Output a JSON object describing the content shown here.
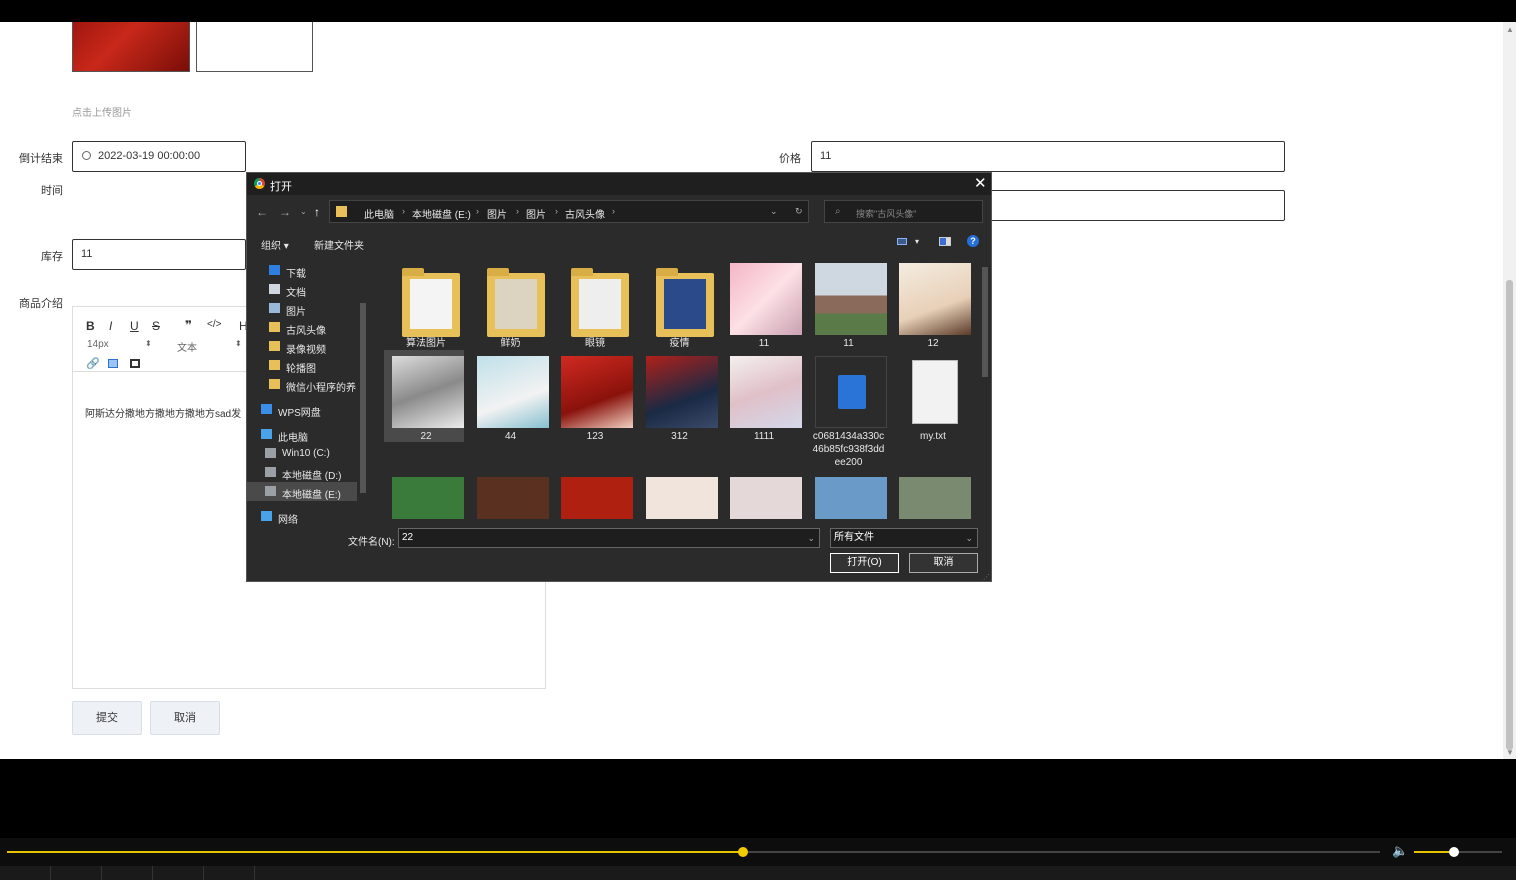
{
  "form": {
    "upload_hint": "点击上传图片",
    "countdown_label_1": "倒计结束",
    "countdown_label_2": "时间",
    "countdown_value": "2022-03-19 00:00:00",
    "price_label": "价格",
    "price_value": "11",
    "stock_label": "库存",
    "stock_value": "11",
    "desc_label": "商品介绍",
    "editor_font_size": "14px",
    "editor_block_type": "文本",
    "editor_content": "阿斯达分撒地方撒地方撒地方sad发",
    "submit_label": "提交",
    "cancel_label": "取消"
  },
  "dialog": {
    "title": "打开",
    "breadcrumb": [
      "此电脑",
      "本地磁盘 (E:)",
      "图片",
      "图片",
      "古风头像"
    ],
    "search_placeholder": "搜索\"古风头像\"",
    "organize_label": "组织 ▾",
    "new_folder_label": "新建文件夹",
    "nav_items": [
      {
        "label": "下载",
        "icon": "download-icon"
      },
      {
        "label": "文档",
        "icon": "document-icon"
      },
      {
        "label": "图片",
        "icon": "pictures-icon"
      },
      {
        "label": "古风头像",
        "icon": "folder-icon"
      },
      {
        "label": "录像视频",
        "icon": "folder-icon"
      },
      {
        "label": "轮播图",
        "icon": "folder-icon"
      },
      {
        "label": "微信小程序的养",
        "icon": "folder-icon"
      },
      {
        "label": "WPS网盘",
        "icon": "cloud-icon"
      },
      {
        "label": "此电脑",
        "icon": "computer-icon"
      },
      {
        "label": "Win10 (C:)",
        "icon": "drive-icon"
      },
      {
        "label": "本地磁盘 (D:)",
        "icon": "drive-icon"
      },
      {
        "label": "本地磁盘 (E:)",
        "icon": "drive-icon"
      },
      {
        "label": "网络",
        "icon": "network-icon"
      }
    ],
    "files": [
      {
        "name": "算法图片",
        "kind": "folder"
      },
      {
        "name": "鲜奶",
        "kind": "folder"
      },
      {
        "name": "眼镜",
        "kind": "folder"
      },
      {
        "name": "疫情",
        "kind": "folder"
      },
      {
        "name": "11",
        "kind": "image"
      },
      {
        "name": "11",
        "kind": "image"
      },
      {
        "name": "12",
        "kind": "image"
      },
      {
        "name": "22",
        "kind": "image"
      },
      {
        "name": "44",
        "kind": "image"
      },
      {
        "name": "123",
        "kind": "image"
      },
      {
        "name": "312",
        "kind": "image"
      },
      {
        "name": "1111",
        "kind": "image"
      },
      {
        "name": "c0681434a330c46b85fc938f3ddee200",
        "kind": "mp4"
      },
      {
        "name": "my.txt",
        "kind": "txt"
      }
    ],
    "filename_label": "文件名(N):",
    "filename_value": "22",
    "filetype_value": "所有文件",
    "open_label": "打开(O)",
    "cancel_label": "取消"
  },
  "player": {
    "progress": 0.536,
    "volume": 0.45,
    "accent": "#e8c400"
  }
}
